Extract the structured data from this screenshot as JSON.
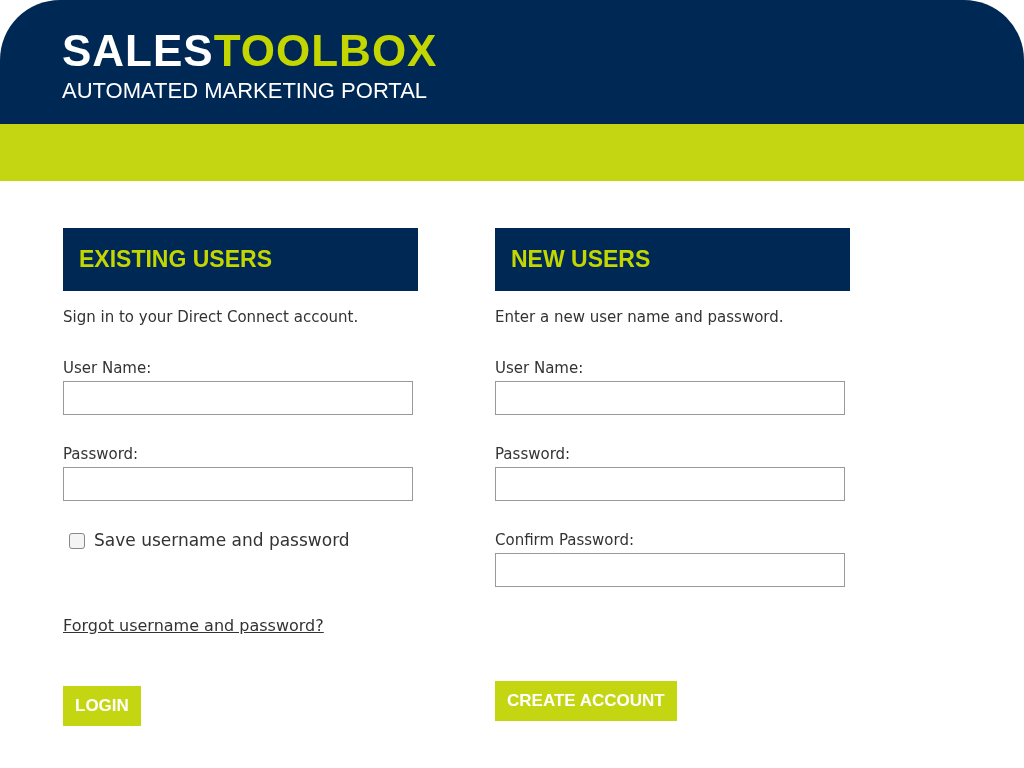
{
  "header": {
    "logo_first": "SALES",
    "logo_second": "TOOLBOX",
    "tagline": "AUTOMATED MARKETING PORTAL"
  },
  "existing_users": {
    "heading": "EXISTING USERS",
    "intro": "Sign in to your Direct Connect account.",
    "fields": [
      {
        "label": "User Name:"
      },
      {
        "label": "Password:"
      }
    ],
    "remember": {
      "label": "Save username and password",
      "checked": false
    },
    "forgot_link": "Forgot username and password?",
    "button": "LOGIN"
  },
  "new_users": {
    "heading": "NEW USERS",
    "intro": "Enter a new user name and password.",
    "fields": [
      {
        "label": "User Name:"
      },
      {
        "label": "Password:"
      },
      {
        "label": "Confirm Password:"
      }
    ],
    "button": "CREATE ACCOUNT"
  }
}
